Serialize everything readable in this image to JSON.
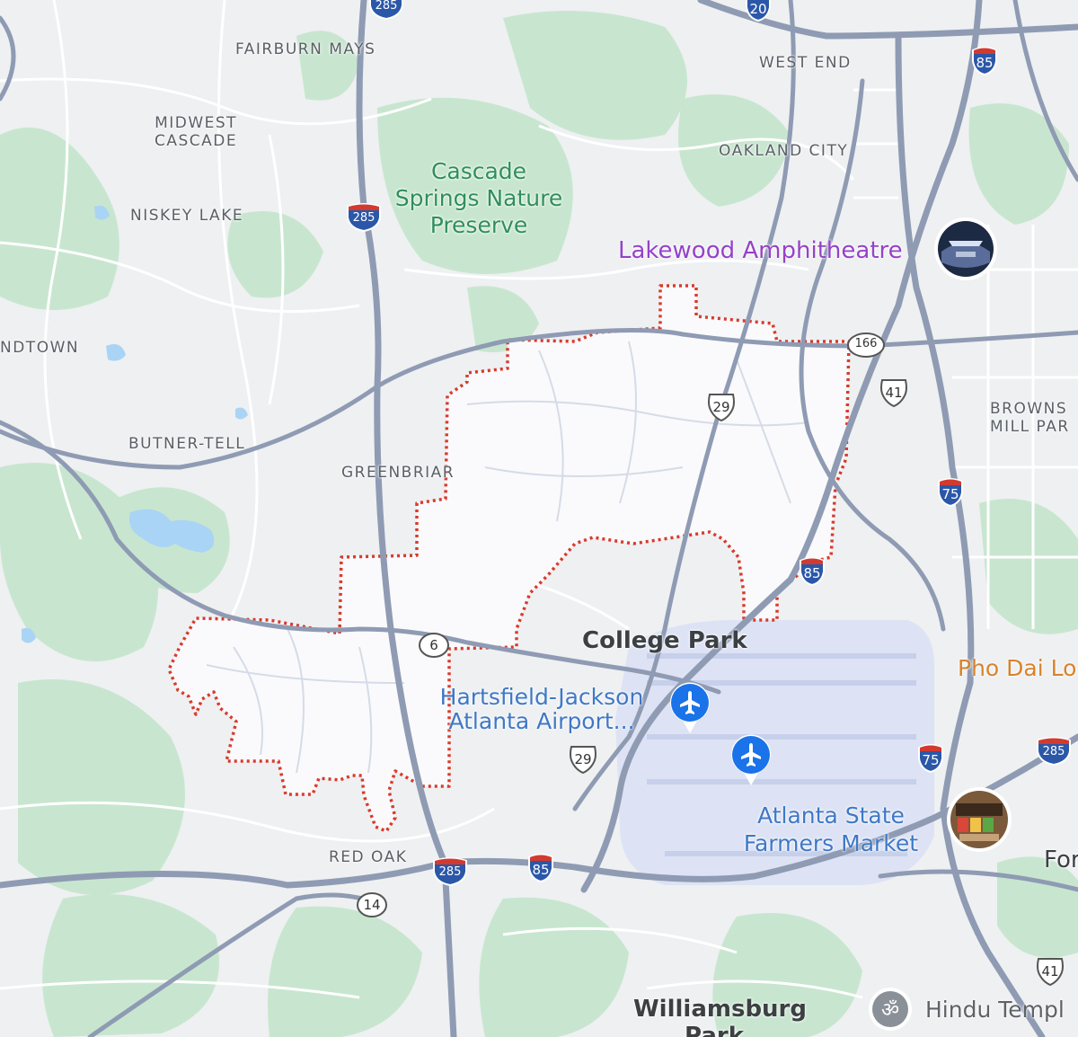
{
  "map": {
    "colors": {
      "land": "#eef0f2",
      "park": "#c8e6cf",
      "water": "#a9d4f5",
      "road": "#8f9bb3",
      "minor_road": "#ffffff",
      "boundary": "#d93a2b",
      "city_fill": "#fafafc",
      "airport": "#dde3f4"
    },
    "neighborhoods": [
      {
        "name": "fairburn-mays",
        "label": "FAIRBURN MAYS"
      },
      {
        "name": "west-end",
        "label": "WEST END"
      },
      {
        "name": "midwest-cascade",
        "label": "MIDWEST\nCASCADE"
      },
      {
        "name": "oakland-city",
        "label": "OAKLAND CITY"
      },
      {
        "name": "niskey-lake",
        "label": "NISKEY LAKE"
      },
      {
        "name": "ndtown",
        "label": "NDTOWN"
      },
      {
        "name": "browns-mill-park",
        "label": "BROWNS\nMILL PAR"
      },
      {
        "name": "butner-tell",
        "label": "BUTNER-TELL"
      },
      {
        "name": "greenbriar",
        "label": "GREENBRIAR"
      },
      {
        "name": "red-oak",
        "label": "RED OAK"
      }
    ],
    "parks": [
      {
        "name": "cascade-springs",
        "label": "Cascade\nSprings Nature\nPreserve"
      }
    ],
    "pois": {
      "lakewood": {
        "label": "Lakewood Amphitheatre",
        "icon": "photo-thumbnail-icon"
      },
      "airport": {
        "label": "Hartsfield-Jackson\nAtlanta Airport...",
        "icon": "airplane-icon"
      },
      "farmers_market": {
        "label": "Atlanta State\nFarmers Market",
        "icon": "photo-thumbnail-icon"
      },
      "pho": {
        "label": "Pho Dai Lo"
      },
      "hindu_temple": {
        "label": "Hindu Templ",
        "icon": "om-icon"
      },
      "forest": {
        "label": "For"
      }
    },
    "cities": [
      {
        "name": "college-park",
        "label": "College Park"
      },
      {
        "name": "williamsburg-park",
        "label": "Williamsburg\nPark"
      }
    ],
    "shields": [
      {
        "name": "i285-top",
        "type": "interstate",
        "number": "285"
      },
      {
        "name": "i20",
        "type": "interstate",
        "number": "20"
      },
      {
        "name": "i85-ne",
        "type": "interstate",
        "number": "85"
      },
      {
        "name": "i285-w",
        "type": "interstate",
        "number": "285"
      },
      {
        "name": "sr166",
        "type": "state",
        "number": "166"
      },
      {
        "name": "us41-n",
        "type": "us",
        "number": "41"
      },
      {
        "name": "us29-n",
        "type": "us",
        "number": "29"
      },
      {
        "name": "i75-n",
        "type": "interstate",
        "number": "75"
      },
      {
        "name": "i85-mid",
        "type": "interstate",
        "number": "85"
      },
      {
        "name": "sr6",
        "type": "state",
        "number": "6"
      },
      {
        "name": "us29-s",
        "type": "us",
        "number": "29"
      },
      {
        "name": "i75-s",
        "type": "interstate",
        "number": "75"
      },
      {
        "name": "i285-e",
        "type": "interstate",
        "number": "285"
      },
      {
        "name": "i285-s",
        "type": "interstate",
        "number": "285"
      },
      {
        "name": "i85-s",
        "type": "interstate",
        "number": "85"
      },
      {
        "name": "sr14",
        "type": "state",
        "number": "14"
      },
      {
        "name": "us41-s",
        "type": "us",
        "number": "41"
      }
    ]
  }
}
